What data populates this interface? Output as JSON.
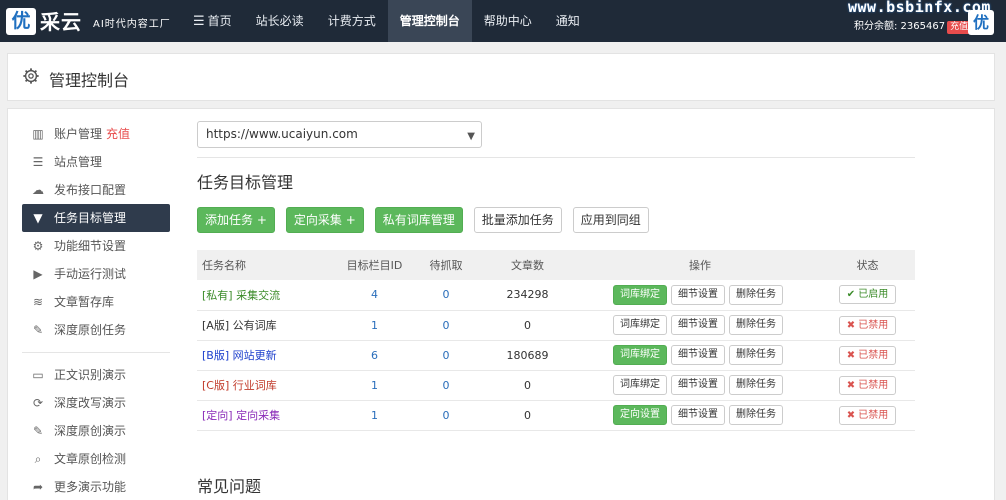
{
  "brand": {
    "logo_char": "优",
    "name": "采云",
    "slogan": "AI时代内容工厂"
  },
  "nav": {
    "menu_glyph": "☰",
    "items": [
      "首页",
      "站长必读",
      "计费方式",
      "管理控制台",
      "帮助中心",
      "通知"
    ],
    "active_index": 3
  },
  "watermark": "www.bsbinfx.com",
  "account": {
    "points_text": "积分余额: 2365467",
    "recharge_label": "充值",
    "avatar_char": "优"
  },
  "page": {
    "title": "管理控制台"
  },
  "sidebar": {
    "group1": [
      {
        "icon": "bar-chart-icon",
        "glyph": "▥",
        "label": "账户管理",
        "extra": "充值"
      },
      {
        "icon": "list-icon",
        "glyph": "☰",
        "label": "站点管理"
      },
      {
        "icon": "cloud-upload-icon",
        "glyph": "☁",
        "label": "发布接口配置"
      },
      {
        "icon": "filter-icon",
        "glyph": "▼",
        "label": "任务目标管理",
        "active": true
      },
      {
        "icon": "cogs-icon",
        "glyph": "⚙",
        "label": "功能细节设置"
      },
      {
        "icon": "play-circle-icon",
        "glyph": "▶",
        "label": "手动运行测试"
      },
      {
        "icon": "database-icon",
        "glyph": "≋",
        "label": "文章暂存库"
      },
      {
        "icon": "edit-icon",
        "glyph": "✎",
        "label": "深度原创任务"
      }
    ],
    "group2": [
      {
        "icon": "monitor-icon",
        "glyph": "▭",
        "label": "正文识别演示"
      },
      {
        "icon": "refresh-icon",
        "glyph": "⟳",
        "label": "深度改写演示"
      },
      {
        "icon": "edit-icon",
        "glyph": "✎",
        "label": "深度原创演示"
      },
      {
        "icon": "search-icon",
        "glyph": "⌕",
        "label": "文章原创检测"
      },
      {
        "icon": "share-icon",
        "glyph": "➦",
        "label": "更多演示功能"
      }
    ]
  },
  "site_select": {
    "value": "https://www.ucaiyun.com",
    "caret": "▼"
  },
  "section": {
    "title": "任务目标管理",
    "faq_title": "常见问题"
  },
  "buttons": [
    {
      "label": "添加任务 +",
      "style": "green"
    },
    {
      "label": "定向采集 +",
      "style": "green"
    },
    {
      "label": "私有词库管理",
      "style": "green"
    },
    {
      "label": "批量添加任务",
      "style": "default"
    },
    {
      "label": "应用到同组",
      "style": "default"
    }
  ],
  "table": {
    "headers": [
      "任务名称",
      "目标栏目ID",
      "待抓取",
      "文章数",
      "操作",
      "状态"
    ],
    "rows": [
      {
        "tag": "[私有]",
        "name": "采集交流",
        "tag_class": "tag-green",
        "column_id": "4",
        "pending": "0",
        "articles": "234298",
        "op1": "词库绑定",
        "op1_green": true,
        "op2": "细节设置",
        "op3": "删除任务",
        "status": "✔ 已启用",
        "status_on": true
      },
      {
        "tag": "[A版]",
        "name": "公有词库",
        "tag_class": "tag-dark",
        "column_id": "1",
        "pending": "0",
        "articles": "0",
        "op1": "词库绑定",
        "op1_green": false,
        "op2": "细节设置",
        "op3": "删除任务",
        "status": "✖ 已禁用",
        "status_on": false
      },
      {
        "tag": "[B版]",
        "name": "网站更新",
        "tag_class": "tag-blue",
        "column_id": "6",
        "pending": "0",
        "articles": "180689",
        "op1": "词库绑定",
        "op1_green": true,
        "op2": "细节设置",
        "op3": "删除任务",
        "status": "✖ 已禁用",
        "status_on": false
      },
      {
        "tag": "[C版]",
        "name": "行业词库",
        "tag_class": "tag-red",
        "column_id": "1",
        "pending": "0",
        "articles": "0",
        "op1": "词库绑定",
        "op1_green": false,
        "op2": "细节设置",
        "op3": "删除任务",
        "status": "✖ 已禁用",
        "status_on": false
      },
      {
        "tag": "[定向]",
        "name": "定向采集",
        "tag_class": "tag-purple",
        "column_id": "1",
        "pending": "0",
        "articles": "0",
        "op1": "定向设置",
        "op1_green": true,
        "op2": "细节设置",
        "op3": "删除任务",
        "status": "✖ 已禁用",
        "status_on": false
      }
    ]
  },
  "colors": {
    "topbar": "#1f2a38",
    "accent_green": "#5cb85c",
    "sidebar_active": "#2f3b4c",
    "danger": "#e84c4c"
  }
}
